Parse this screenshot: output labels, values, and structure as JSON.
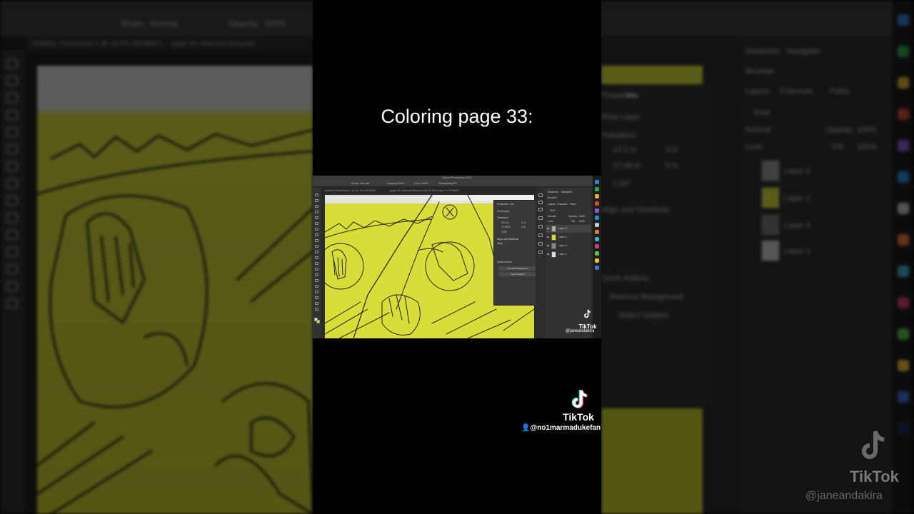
{
  "caption": "Coloring page 33:",
  "watermark": {
    "brand": "TikTok",
    "handle": "@no1marmadukefan",
    "inner_handle": "@janeandakira",
    "background_handle": "@janeandakira"
  },
  "screenshot": {
    "app_title": "Adobe Photoshop 2022",
    "options": {
      "mode_label": "Mode:",
      "mode_value": "Normal",
      "opacity_label": "Opacity:",
      "opacity_value": "100%",
      "flow_label": "Flow:",
      "flow_value": "100%",
      "smoothing_label": "Smoothing:",
      "smoothing_value": "0%"
    },
    "tabs": [
      "Untitled_Panorama-1 @ 16.6% (RGB/8*)",
      "page 33 charcoal final.psd @ 33.3% (Layer 3, RGB/8*)"
    ],
    "properties": {
      "tab_properties": "Properties",
      "tab_info": "Info",
      "pixel_layer": "Pixel Layer",
      "transform": "Transform",
      "w_value": "14.2 in",
      "h_value": "17.08 in",
      "x_value": "0 in",
      "y_value": "0 in",
      "angle_value": "0.00°",
      "align": "Align and Distribute",
      "align_sub": "Align:",
      "quick_actions": "Quick Actions",
      "remove_bg": "Remove Background",
      "select_subject": "Select Subject"
    },
    "layers_panel": {
      "tab_swatches": "Swatches",
      "tab_navigator": "Navigator",
      "tab_brushes": "Brushes",
      "tab_layers": "Layers",
      "tab_channels": "Channels",
      "tab_paths": "Paths",
      "kind": "Kind",
      "blend": "Normal",
      "opacity_label": "Opacity:",
      "opacity": "100%",
      "lock_label": "Lock:",
      "fill_label": "Fill:",
      "fill": "100%",
      "layers": [
        "Layer 3",
        "Layer 2",
        "Layer 0",
        "Layer 1"
      ]
    }
  },
  "background": {
    "mode_label": "Mode:",
    "mode_value": "Normal",
    "opacity_label": "Opacity:",
    "opacity_value": "100%",
    "tab1": "Untitled_Panorama-1 @ 16.6% (RGB/8*)",
    "tab2": "page 33 charcoal final.psd",
    "tab_properties": "Properties",
    "tab_info": "Info",
    "pixel_layer": "Pixel Layer",
    "transform": "Transform",
    "w_value": "14.2 in",
    "h_value": "17.08 in",
    "x_value": "0 in",
    "y_value": "0 in",
    "angle_value": "0.00°",
    "align": "Align and Distribute",
    "quick_actions": "Quick Actions",
    "remove_bg": "Remove Background",
    "select_subject": "Select Subject",
    "tab_swatches": "Swatches",
    "tab_navigator": "Navigator",
    "tab_brushes": "Brushes",
    "tab_layers": "Layers",
    "tab_channels": "Channels",
    "tab_paths": "Paths",
    "kind": "Kind",
    "blend": "Normal",
    "opacity_label2": "Opacity:",
    "opacity2": "100%",
    "lock_label": "Lock:",
    "fill_label": "Fill:",
    "fill": "100%",
    "layers": [
      "Layer 3",
      "Layer 2",
      "Layer 0",
      "Layer 1"
    ]
  },
  "colors": {
    "canvas_yellow": "#d9dd3a",
    "ps_panel": "#2b2b2b",
    "caption_text": "#ffffff"
  }
}
